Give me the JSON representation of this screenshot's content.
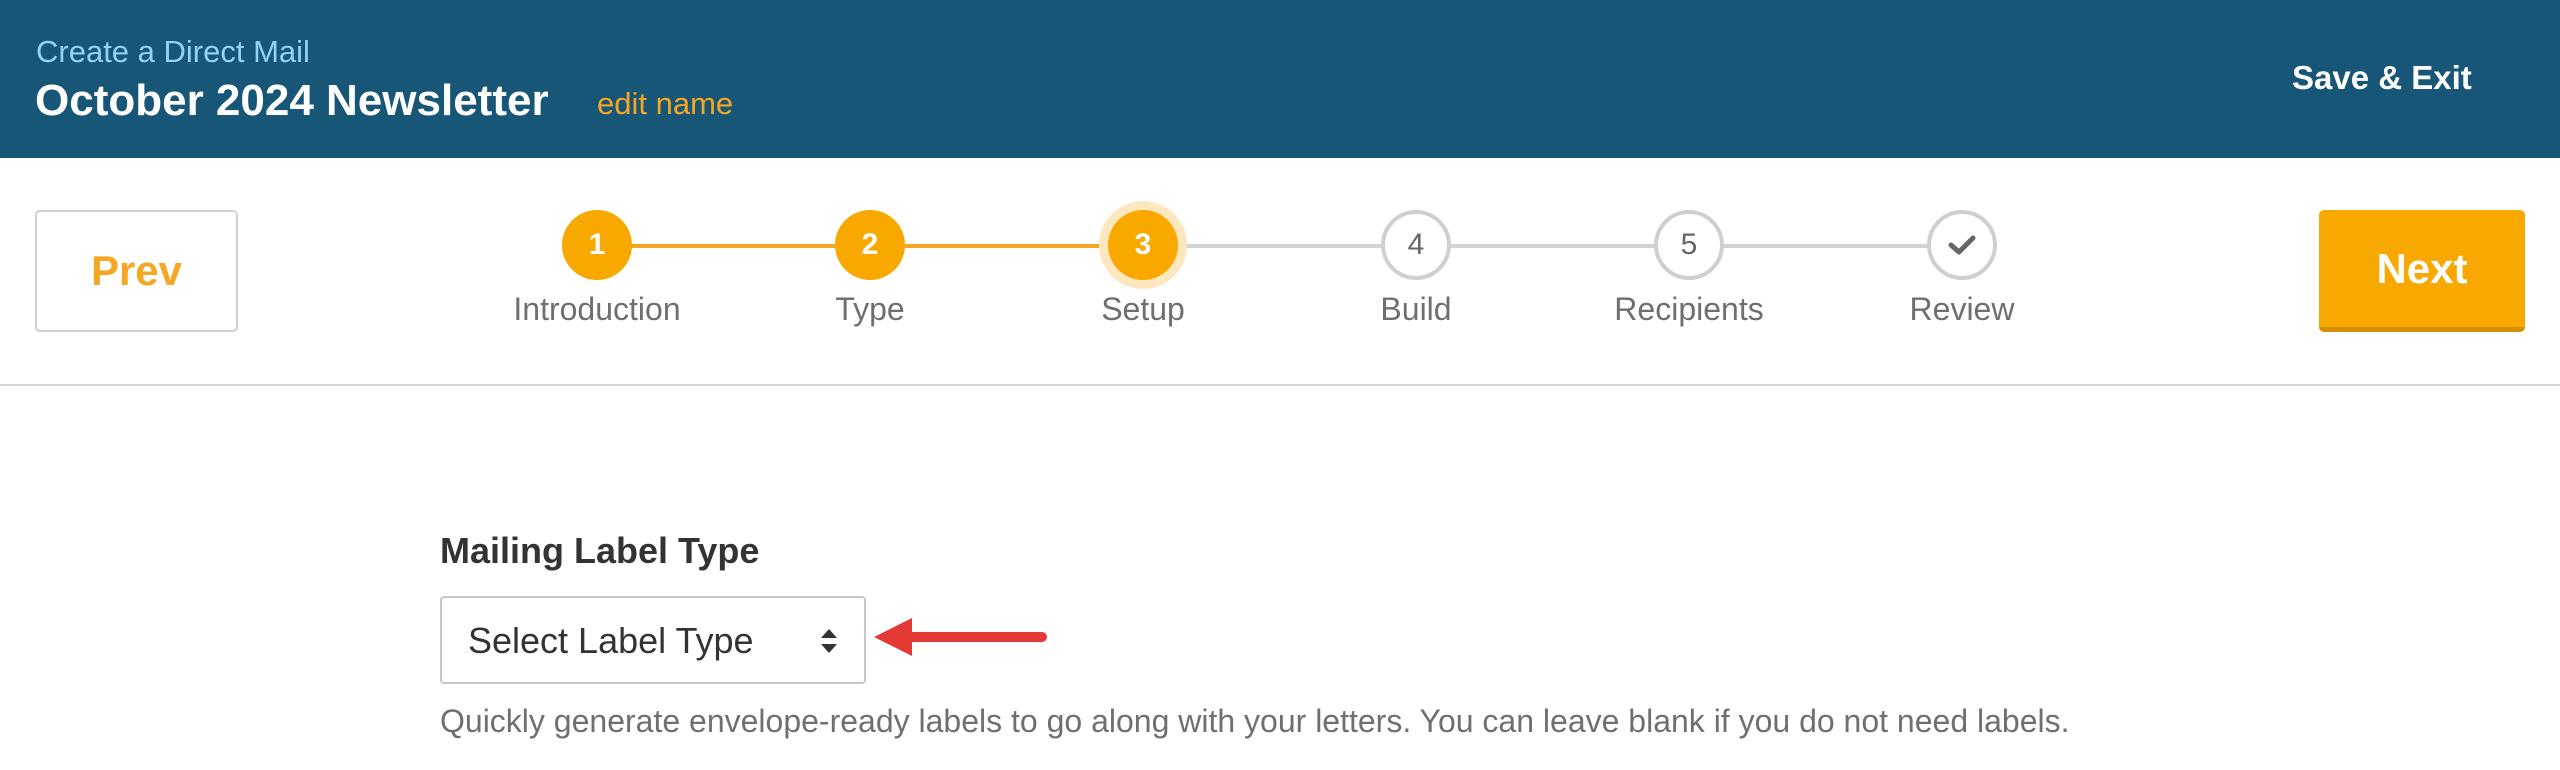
{
  "header": {
    "eyebrow": "Create a Direct Mail",
    "title": "October 2024 Newsletter",
    "edit_name_label": "edit name",
    "save_exit_label": "Save & Exit"
  },
  "navigation": {
    "prev_label": "Prev",
    "next_label": "Next"
  },
  "stepper": {
    "steps": [
      {
        "number": "1",
        "label": "Introduction",
        "state": "done"
      },
      {
        "number": "2",
        "label": "Type",
        "state": "done"
      },
      {
        "number": "3",
        "label": "Setup",
        "state": "current"
      },
      {
        "number": "4",
        "label": "Build",
        "state": "todo"
      },
      {
        "number": "5",
        "label": "Recipients",
        "state": "todo"
      },
      {
        "number": "",
        "label": "Review",
        "state": "todo",
        "icon": "check-icon"
      }
    ]
  },
  "form": {
    "mailing_label_type": {
      "label": "Mailing Label Type",
      "selected": "Select Label Type",
      "help": "Quickly generate envelope-ready labels to go along with your letters. You can leave blank if you do not need labels."
    }
  },
  "colors": {
    "header_bg": "#175676",
    "accent": "#f9a800",
    "eyebrow": "#8fd3f5",
    "annotation_arrow": "#e53935"
  }
}
